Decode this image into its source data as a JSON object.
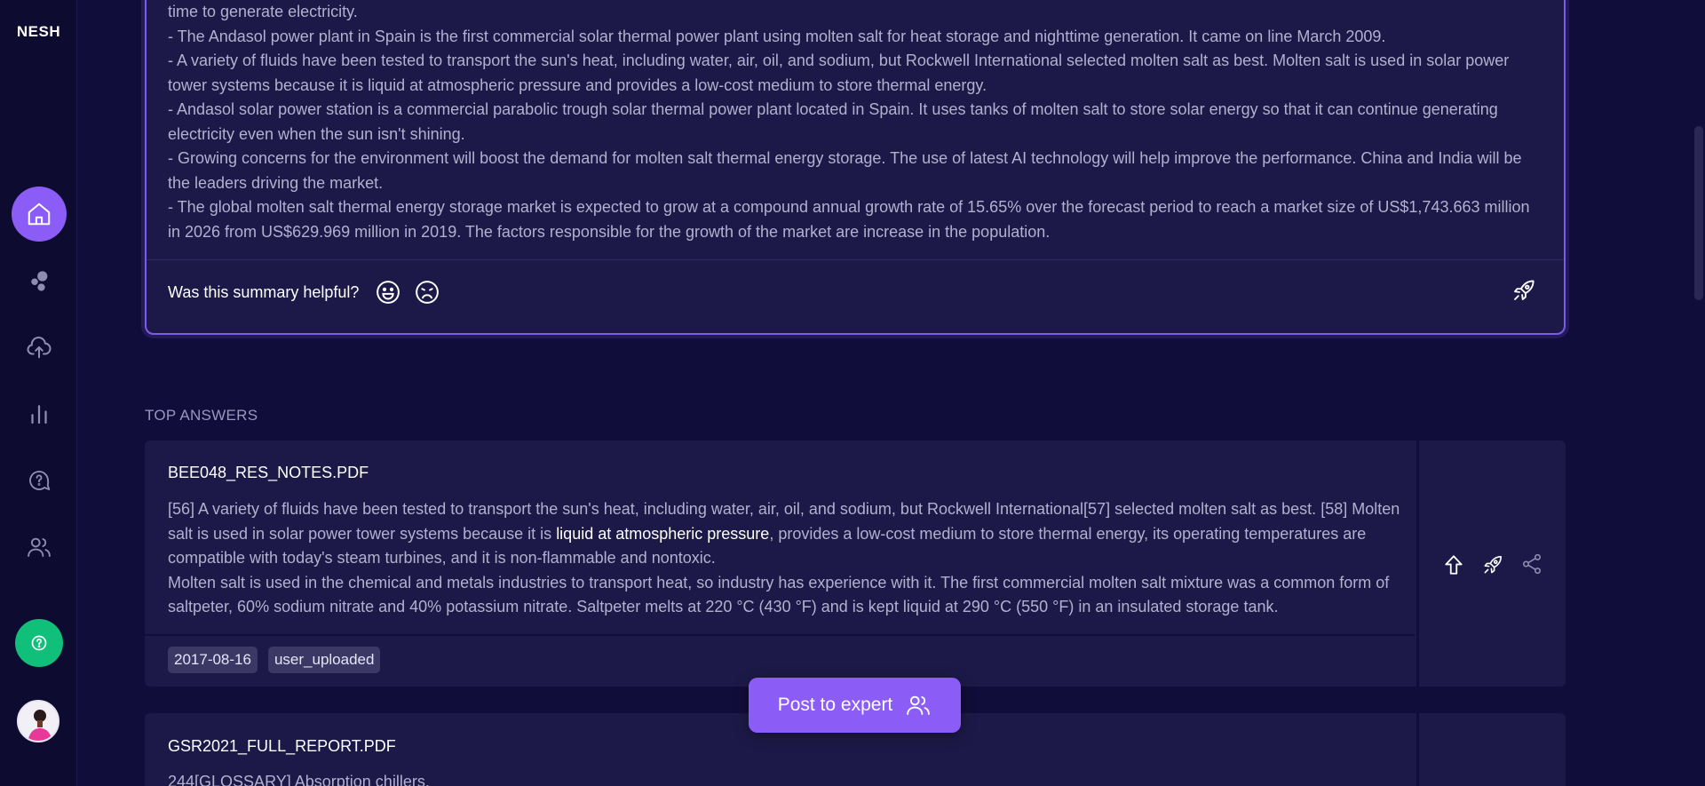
{
  "app": {
    "logo": "NESH"
  },
  "sidebar": {
    "items": [
      {
        "name": "home",
        "icon": "home-icon",
        "active": true
      },
      {
        "name": "bubbles",
        "icon": "bubbles-icon",
        "active": false
      },
      {
        "name": "upload",
        "icon": "cloud-upload-icon",
        "active": false
      },
      {
        "name": "analytics",
        "icon": "bar-chart-icon",
        "active": false
      },
      {
        "name": "questions",
        "icon": "question-chat-icon",
        "active": false
      },
      {
        "name": "users",
        "icon": "users-icon",
        "active": false
      }
    ],
    "help_icon": "help-icon",
    "accent": "#8b5cf6",
    "help_color": "#10c07a"
  },
  "summary": {
    "lines": [
      "time to generate electricity.",
      "- The Andasol power plant in Spain is the first commercial solar thermal power plant using molten salt for heat storage and nighttime generation. It came on line March 2009.",
      "- A variety of fluids have been tested to transport the sun's heat, including water, air, oil, and sodium, but Rockwell International selected molten salt as best. Molten salt is used in solar power tower systems because it is liquid at atmospheric pressure and provides a low-cost medium to store thermal energy.",
      "- Andasol solar power station is a commercial parabolic trough solar thermal power plant located in Spain. It uses tanks of molten salt to store solar energy so that it can continue generating electricity even when the sun isn't shining.",
      "- Growing concerns for the environment will boost the demand for molten salt thermal energy storage. The use of latest AI technology will help improve the performance. China and India will be the leaders driving the market.",
      "- The global molten salt thermal energy storage market is expected to grow at a compound annual growth rate of 15.65% over the forecast period to reach a market size of US$1,743.663 million in 2026 from US$629.969 million in 2019. The factors responsible for the growth of the market are increase in the population."
    ],
    "helpful_question": "Was this summary helpful?"
  },
  "top_answers": {
    "title": "TOP ANSWERS",
    "items": [
      {
        "file": "BEE048_RES_NOTES.PDF",
        "body_before": "[56] A variety of fluids have been tested to transport the sun's heat, including water, air, oil, and sodium, but Rockwell International[57] selected molten salt as best. [58] Molten salt is used in solar power tower systems because it is ",
        "highlight": "liquid at atmospheric pressure",
        "body_after": ", provides a low-cost medium to store thermal energy, its operating temperatures are compatible with today's steam turbines, and it is non-flammable and nontoxic.",
        "body_second": "Molten salt is used in the chemical and metals industries to transport heat, so industry has experience with it. The first commercial molten salt mixture was a common form of saltpeter, 60% sodium nitrate and 40% potassium nitrate. Saltpeter melts at 220 °C (430 °F) and is kept liquid at 290 °C (550 °F) in an insulated storage tank.",
        "tags": [
          "2017-08-16",
          "user_uploaded"
        ]
      },
      {
        "file": "GSR2021_FULL_REPORT.PDF",
        "body": "244[GLOSSARY] Absorption chillers."
      }
    ]
  },
  "post_button": {
    "label": "Post to expert"
  }
}
